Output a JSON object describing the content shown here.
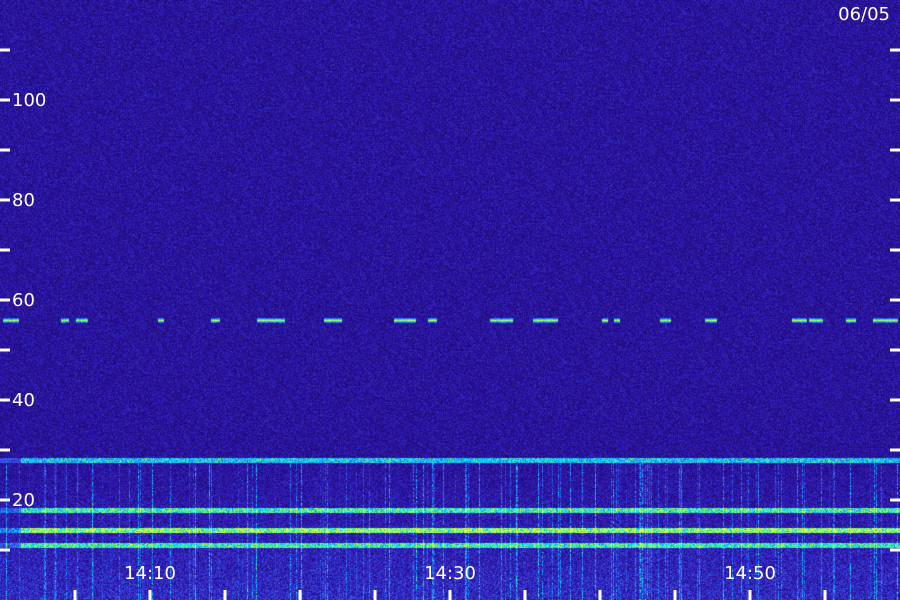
{
  "chart_data": {
    "type": "heatmap",
    "title": "",
    "date_label": "06/05",
    "xlabel": "",
    "ylabel": "",
    "x_tick_labels": [
      "14:10",
      "14:30",
      "14:50"
    ],
    "y_tick_labels": [
      "20",
      "40",
      "60",
      "80",
      "100"
    ],
    "y_tick_values": [
      20,
      40,
      60,
      80,
      100
    ],
    "ylim": [
      0,
      120
    ],
    "xlim_minutes": [
      0,
      60
    ],
    "x_labeled_minutes": [
      10,
      30,
      50
    ],
    "x_minor_every_minutes": 5,
    "y_minor_every": 10,
    "colormap": [
      "#1a0a5c",
      "#2a10a0",
      "#3a3ad8",
      "#1e90ff",
      "#00e5ff",
      "#7fff4f",
      "#e8ff3a"
    ],
    "features": [
      {
        "name": "tone-56",
        "value": 56,
        "intensity": 0.75
      },
      {
        "name": "band-28",
        "value": 28,
        "intensity": 0.6
      },
      {
        "name": "band-18",
        "value": 18,
        "intensity": 0.7
      },
      {
        "name": "band-14",
        "value": 14,
        "intensity": 0.85
      },
      {
        "name": "band-11",
        "value": 11,
        "intensity": 0.65
      }
    ]
  }
}
